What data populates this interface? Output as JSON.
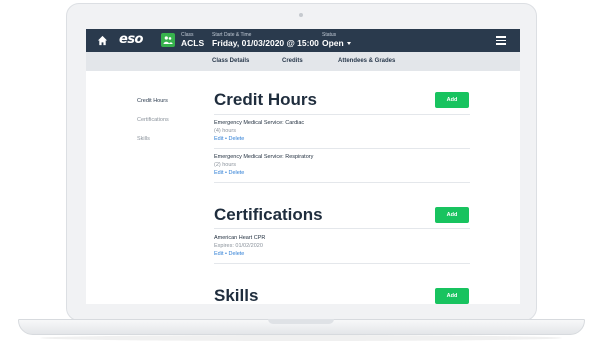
{
  "header": {
    "logo": "eso",
    "class_label": "Class",
    "class_value": "ACLS",
    "date_label": "Start Date & Time",
    "date_value": "Friday, 01/03/2020 @ 15:00",
    "status_label": "Status",
    "status_value": "Open"
  },
  "tabs": [
    {
      "label": "Class Details"
    },
    {
      "label": "Credits"
    },
    {
      "label": "Attendees & Grades"
    }
  ],
  "sidenav": [
    {
      "label": "Credit Hours"
    },
    {
      "label": "Certifications"
    },
    {
      "label": "Skills"
    }
  ],
  "credit_hours": {
    "title": "Credit Hours",
    "add_label": "Add",
    "items": [
      {
        "name": "Emergency Medical Service: Cardiac",
        "sub": "(4) hours",
        "edit": "Edit",
        "sep": " • ",
        "delete": "Delete"
      },
      {
        "name": "Emergency Medical Service: Respiratory",
        "sub": "(2) hours",
        "edit": "Edit",
        "sep": " • ",
        "delete": "Delete"
      }
    ]
  },
  "certifications": {
    "title": "Certifications",
    "add_label": "Add",
    "items": [
      {
        "name": "American Heart CPR",
        "sub": "Expires: 01/02/2020",
        "edit": "Edit",
        "sep": " • ",
        "delete": "Delete"
      }
    ]
  },
  "skills": {
    "title": "Skills",
    "add_label": "Add"
  },
  "colors": {
    "header_bg": "#2a3a4d",
    "accent_green": "#18c35f",
    "link_blue": "#2f7fd6",
    "tab_bar_bg": "#e3e6ea"
  },
  "icons": [
    "home-icon",
    "class-icon",
    "status-caret-icon",
    "menu-icon"
  ]
}
